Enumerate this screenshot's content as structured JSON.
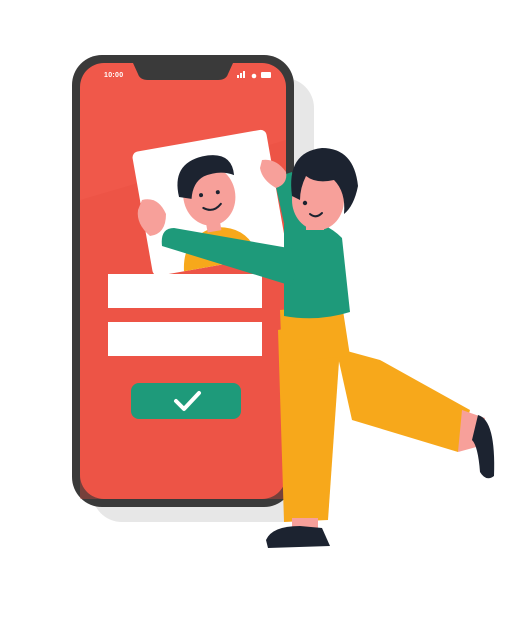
{
  "status_bar": {
    "time": "10:00"
  },
  "icons": {
    "signal": "signal-bars-icon",
    "wifi": "wifi-icon",
    "battery": "battery-icon",
    "confirm": "checkmark-icon"
  },
  "colors": {
    "screen": "#f0584a",
    "phone_frame": "#3a3a3a",
    "button": "#1e9a7a",
    "shirt": "#1e9a7a",
    "pants": "#f7a81b",
    "photo_shirt": "#f7a81b",
    "skin": "#f7a09a",
    "hair": "#1c2330",
    "input_field": "#ffffff"
  },
  "form": {
    "fields": [
      {
        "value": ""
      },
      {
        "value": ""
      }
    ]
  }
}
